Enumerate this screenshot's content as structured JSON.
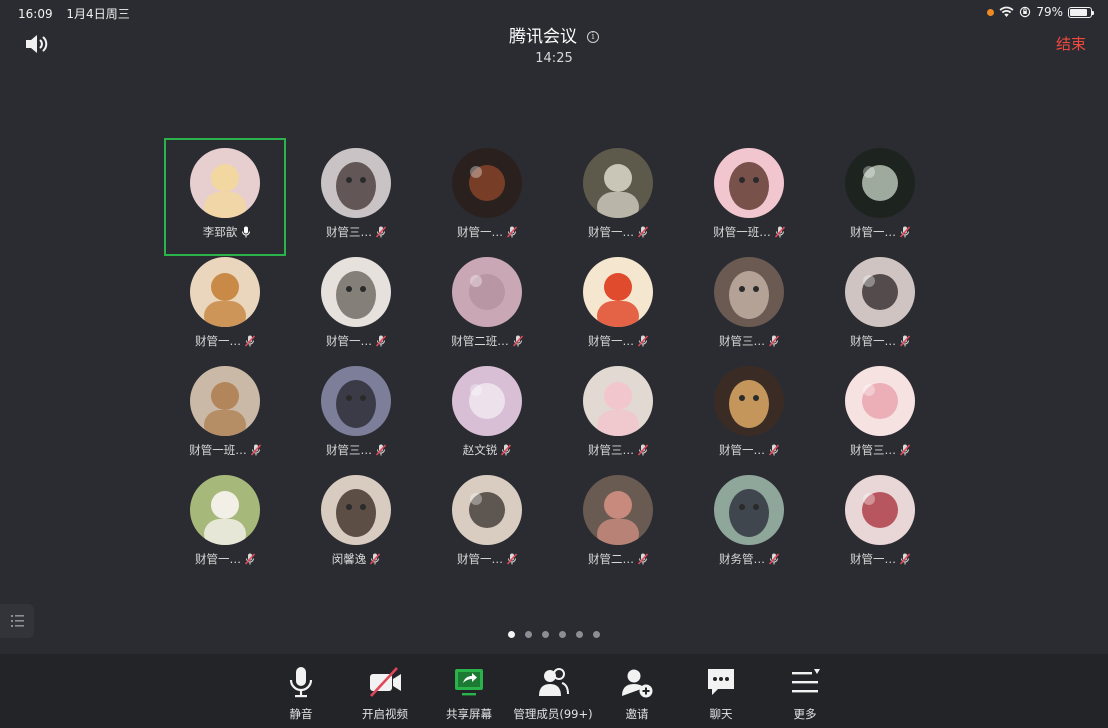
{
  "status_bar": {
    "time": "16:09",
    "date": "1月4日周三",
    "battery": "79%",
    "battery_level": 0.79
  },
  "header": {
    "title": "腾讯会议",
    "timer": "14:25",
    "end_label": "结束"
  },
  "participants": [
    {
      "name": "李郅歆",
      "muted": false,
      "active": true,
      "icon": "bear-avatar",
      "bg": "#e8cfcf",
      "fg": "#f2d7a0"
    },
    {
      "name": "财管三…",
      "muted": true,
      "active": false,
      "icon": "girl-photo-avatar",
      "bg": "#c9c3c5",
      "fg": "#4a3b3a"
    },
    {
      "name": "财管一…",
      "muted": true,
      "active": false,
      "icon": "sparkler-avatar",
      "bg": "#2a211f",
      "fg": "#9a4a2a"
    },
    {
      "name": "财管一…",
      "muted": true,
      "active": false,
      "icon": "waterfall-avatar",
      "bg": "#5e5a4b",
      "fg": "#c9c6b8"
    },
    {
      "name": "财管一班…",
      "muted": true,
      "active": false,
      "icon": "anime-girl-avatar",
      "bg": "#f1c6cf",
      "fg": "#5a3328"
    },
    {
      "name": "财管一…",
      "muted": true,
      "active": false,
      "icon": "sketch-avatar",
      "bg": "#1d2420",
      "fg": "#d6e4d3"
    },
    {
      "name": "财管一…",
      "muted": true,
      "active": false,
      "icon": "shiba-dog-avatar",
      "bg": "#e9d6bd",
      "fg": "#c98a48"
    },
    {
      "name": "财管一…",
      "muted": true,
      "active": false,
      "icon": "spongebob-sketch-avatar",
      "bg": "#e6e1dc",
      "fg": "#6d6660"
    },
    {
      "name": "财管二班…",
      "muted": true,
      "active": false,
      "icon": "pink-photo-avatar",
      "bg": "#caa7b4",
      "fg": "#b18f9c"
    },
    {
      "name": "财管一…",
      "muted": true,
      "active": false,
      "icon": "cartoon-girl-avatar",
      "bg": "#f4e6cf",
      "fg": "#e04a2d"
    },
    {
      "name": "财管三…",
      "muted": true,
      "active": false,
      "icon": "man-photo-avatar",
      "bg": "#6a5a51",
      "fg": "#c7b4a8"
    },
    {
      "name": "财管一…",
      "muted": true,
      "active": false,
      "icon": "dark-hair-girl-avatar",
      "bg": "#cfc4c2",
      "fg": "#1f1a1a"
    },
    {
      "name": "财管一班…",
      "muted": true,
      "active": false,
      "icon": "sleeping-dog-avatar",
      "bg": "#c9b9a6",
      "fg": "#b2865a"
    },
    {
      "name": "财管三…",
      "muted": true,
      "active": false,
      "icon": "dusk-sky-avatar",
      "bg": "#7d7f9a",
      "fg": "#2a2b33"
    },
    {
      "name": "赵文锐",
      "muted": true,
      "active": false,
      "icon": "cloud-avatar",
      "bg": "#d8bfd6",
      "fg": "#f6eff5"
    },
    {
      "name": "财管三…",
      "muted": true,
      "active": false,
      "icon": "mirror-girl-avatar",
      "bg": "#e2d9d3",
      "fg": "#f1c6cc"
    },
    {
      "name": "财管一…",
      "muted": true,
      "active": false,
      "icon": "bokeh-avatar",
      "bg": "#3a2c24",
      "fg": "#e7b16a"
    },
    {
      "name": "财管三…",
      "muted": true,
      "active": false,
      "icon": "blushing-face-avatar",
      "bg": "#f7e2e2",
      "fg": "#e79aa5"
    },
    {
      "name": "财管一…",
      "muted": true,
      "active": false,
      "icon": "samoyed-dog-avatar",
      "bg": "#a7b97a",
      "fg": "#f2efe7"
    },
    {
      "name": "闵馨逸",
      "muted": true,
      "active": false,
      "icon": "selfie-girl-avatar",
      "bg": "#d8cbbf",
      "fg": "#3d2e27"
    },
    {
      "name": "财管一…",
      "muted": true,
      "active": false,
      "icon": "back-girl-avatar",
      "bg": "#d9cdc2",
      "fg": "#2a2320"
    },
    {
      "name": "财管二…",
      "muted": true,
      "active": false,
      "icon": "flower-bouquet-avatar",
      "bg": "#6a5b52",
      "fg": "#c78a7c"
    },
    {
      "name": "财务管…",
      "muted": true,
      "active": false,
      "icon": "girl-outdoor-avatar",
      "bg": "#8fa69a",
      "fg": "#2b2e3a"
    },
    {
      "name": "财管一…",
      "muted": true,
      "active": false,
      "icon": "red-hair-anime-avatar",
      "bg": "#e9d6d6",
      "fg": "#a3202c"
    }
  ],
  "pager": {
    "pages": 6,
    "current": 0
  },
  "toolbar": [
    {
      "key": "mute",
      "label": "静音",
      "icon": "microphone-icon"
    },
    {
      "key": "video",
      "label": "开启视频",
      "icon": "video-off-icon"
    },
    {
      "key": "share",
      "label": "共享屏幕",
      "icon": "share-screen-icon"
    },
    {
      "key": "members",
      "label": "管理成员(99+)",
      "icon": "members-icon"
    },
    {
      "key": "invite",
      "label": "邀请",
      "icon": "invite-icon"
    },
    {
      "key": "chat",
      "label": "聊天",
      "icon": "chat-icon"
    },
    {
      "key": "more",
      "label": "更多",
      "icon": "more-menu-icon"
    }
  ],
  "colors": {
    "accent_green": "#29b34a",
    "end_red": "#f0473f",
    "muted_mic_red": "#e0485a"
  }
}
